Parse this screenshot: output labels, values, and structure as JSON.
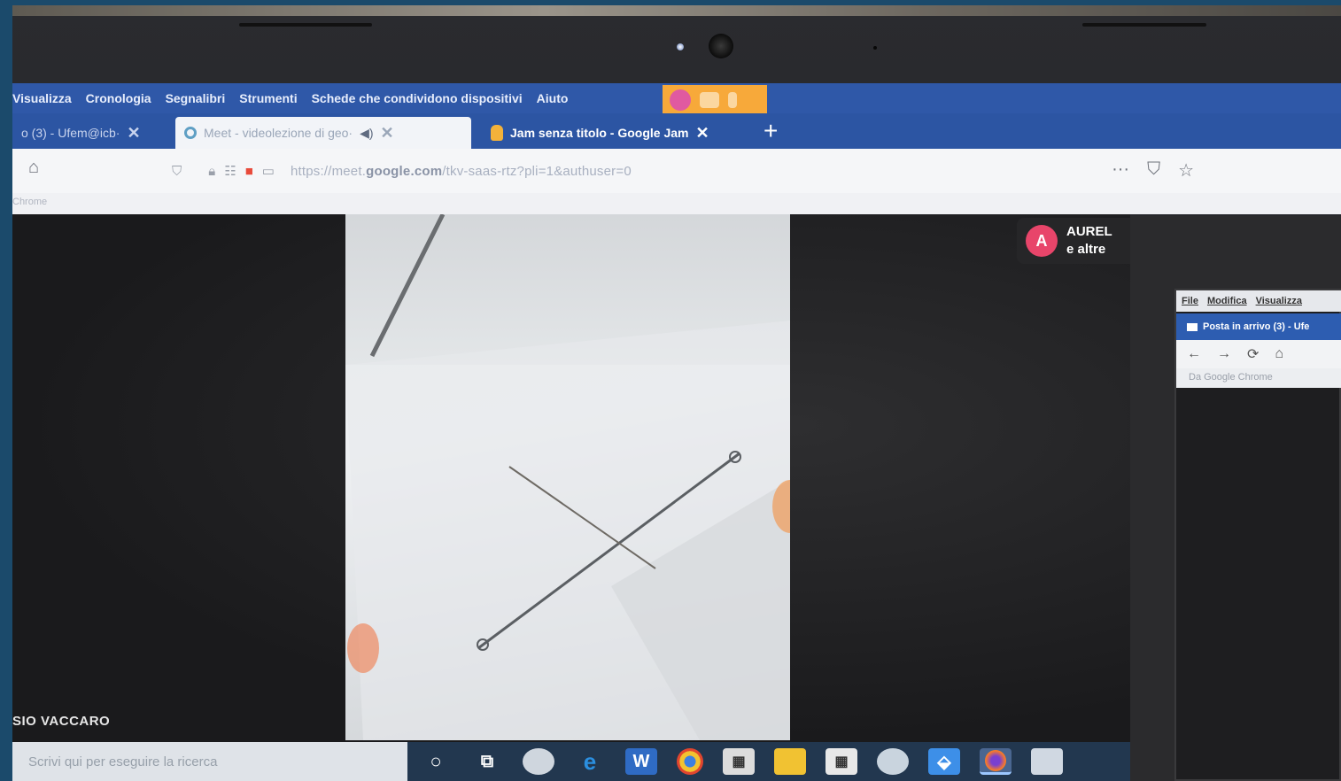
{
  "browser": {
    "menu": [
      "Visualizza",
      "Cronologia",
      "Segnalibri",
      "Strumenti",
      "Schede che condividono dispositivi",
      "Aiuto"
    ],
    "tabs": [
      {
        "label": "o (3) - Ufem@icb·",
        "close": "✕"
      },
      {
        "label": "Meet - videolezione di geo·",
        "close": "✕"
      },
      {
        "label": "Jam senza titolo - Google Jam",
        "close": "✕"
      }
    ],
    "new_tab": "+",
    "url": {
      "prefix": "https://meet.",
      "domain": "google.com",
      "path": "/tkv-saas-rtz?pli=1&authuser=0"
    },
    "bookmarks_label": "Chrome",
    "page_actions": [
      "···",
      "⛉",
      "☆"
    ]
  },
  "meet": {
    "participant_name": "SIO VACCARO",
    "presenter_initial": "A",
    "presenter_line1": "AUREL",
    "presenter_line2": "e altre"
  },
  "second_laptop": {
    "menu": [
      "File",
      "Modifica",
      "Visualizza"
    ],
    "tab_label": "Posta in arrivo (3) - Ufe",
    "nav": [
      "←",
      "→",
      "⟳",
      "⌂"
    ],
    "bookmark": "Da Google Chrome"
  },
  "taskbar": {
    "search_placeholder": "Scrivi qui per eseguire la ricerca",
    "icons": [
      "cortana-circle",
      "task-view",
      "weather",
      "edge",
      "word",
      "chrome",
      "calculator",
      "file-explorer",
      "calendar",
      "paint",
      "dropbox",
      "firefox",
      "snip",
      "app"
    ]
  },
  "colors": {
    "menubar": "#2f58a8",
    "sharing_indicator": "#f7a93a",
    "avatar": "#e8456a",
    "taskbar": "#22374f"
  }
}
